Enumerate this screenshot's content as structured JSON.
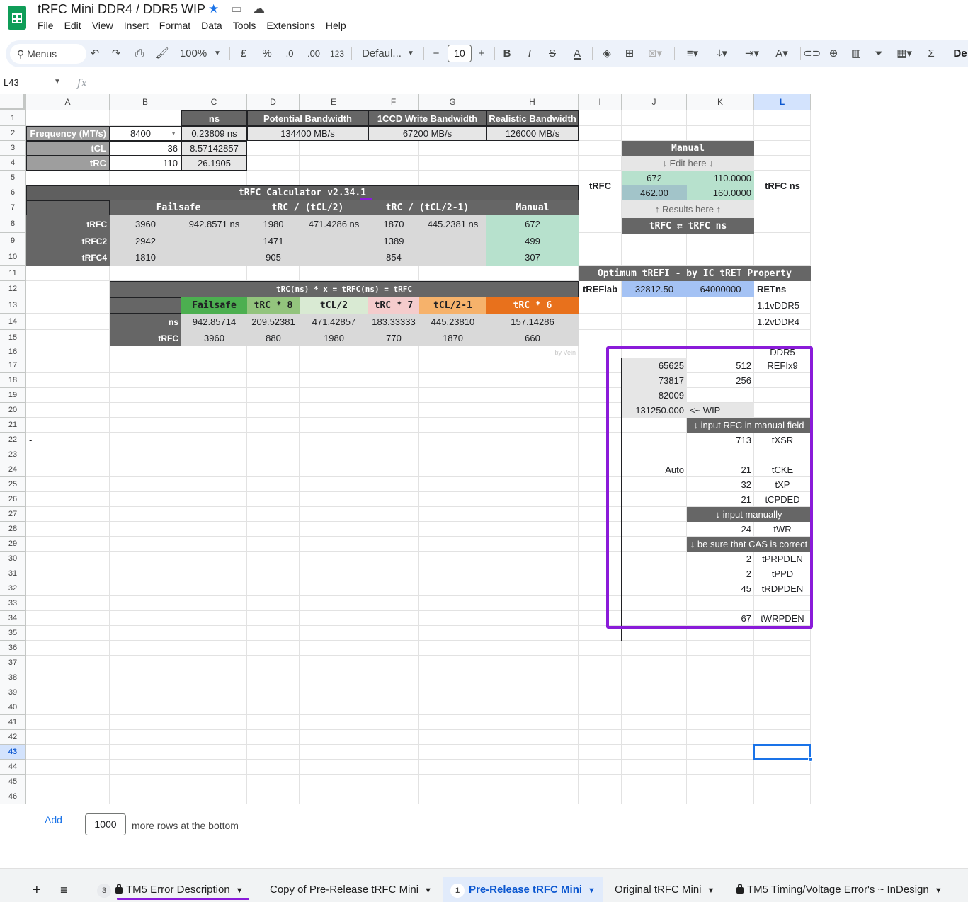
{
  "doc": {
    "title": "tRFC Mini DDR4 / DDR5 WIP"
  },
  "menu": [
    "File",
    "Edit",
    "View",
    "Insert",
    "Format",
    "Data",
    "Tools",
    "Extensions",
    "Help"
  ],
  "toolbar": {
    "search_label": "Menus",
    "zoom": "100%",
    "currency": "£",
    "percent": "%",
    "dec_less": ".0",
    "dec_more": ".00",
    "number_format": "123",
    "font": "Defaul...",
    "font_size": "10",
    "bold": "B",
    "italic": "I",
    "strike": "S",
    "text_color": "A",
    "overflow_label": "De"
  },
  "formula_bar": {
    "name_box": "L43",
    "fx": "fx"
  },
  "columns": [
    "A",
    "B",
    "C",
    "D",
    "E",
    "F",
    "G",
    "H",
    "I",
    "J",
    "K",
    "L"
  ],
  "rows": [
    "1",
    "2",
    "3",
    "4",
    "5",
    "6",
    "7",
    "8",
    "9",
    "10",
    "11",
    "12",
    "13",
    "14",
    "15",
    "16",
    "17",
    "18",
    "19",
    "20",
    "21",
    "22",
    "23",
    "24",
    "25",
    "26",
    "27",
    "28",
    "29",
    "30",
    "31",
    "32",
    "33",
    "34",
    "35",
    "36",
    "37",
    "38",
    "39",
    "40",
    "41",
    "42",
    "43",
    "44",
    "45",
    "46"
  ],
  "cells": {
    "c1": "ns",
    "d1": "Potential Bandwidth",
    "f1": "1CCD Write Bandwidth",
    "h1": "Realistic Bandwidth",
    "a2": "Frequency (MT/s)",
    "b2": "8400",
    "c2": "0.23809 ns",
    "d2": "134400 MB/s",
    "f2": "67200 MB/s",
    "h2": "126000 MB/s",
    "a3": "tCL",
    "b3": "36",
    "c3": "8.57142857",
    "a4": "tRC",
    "b4": "110",
    "c4": "26.1905",
    "calc_title": "tRFC Calculator v2.34.1",
    "b7": "Failsafe",
    "d7": "tRC / (tCL/2)",
    "f7": "tRC / (tCL/2-1)",
    "h7": "Manual",
    "a8": "tRFC",
    "b8": "3960",
    "c8": "942.8571 ns",
    "d8": "1980",
    "e8": "471.4286 ns",
    "f8": "1870",
    "g8": "445.2381 ns",
    "h8": "672",
    "a9": "tRFC2",
    "b9": "2942",
    "d9": "1471",
    "f9": "1389",
    "h9": "499",
    "a10": "tRFC4",
    "b10": "1810",
    "d10": "905",
    "f10": "854",
    "h10": "307",
    "formula_title": "tRC(ns) * x = tRFC(ns) = tRFC",
    "c13": "Failsafe",
    "d13": "tRC * 8",
    "e13": "tCL/2",
    "f13": "tRC * 7",
    "g13": "tCL/2-1",
    "h13": "tRC * 6",
    "b14": "ns",
    "c14": "942.85714",
    "d14": "209.52381",
    "e14": "471.42857",
    "f14": "183.33333",
    "g14": "445.23810",
    "h14": "157.14286",
    "b15": "tRFC",
    "c15": "3960",
    "d15": "880",
    "e15": "1980",
    "f15": "770",
    "g15": "1870",
    "h15": "660",
    "by_vein": "by Vein",
    "manual_title": "Manual",
    "edit_here": "Edit here",
    "j5": "672",
    "k5": "110.0000",
    "j6": "462.00",
    "k6": "160.0000",
    "results_here": "Results here",
    "trfc_conv": "tRFC ⇄ tRFC ns",
    "i6": "tRFC",
    "l6": "tRFC ns",
    "trefi_title": "Optimum tREFI - by IC tRET Property",
    "i12": "tREFlab",
    "j12": "32812.50",
    "k12": "64000000",
    "l12": "RETns",
    "l13": "1.1vDDR5",
    "l14": "1.2vDDR4",
    "l16": "DDR5",
    "j17": "65625",
    "k17": "512",
    "l17": "REFIx9",
    "j18": "73817",
    "k18": "256",
    "j19": "82009",
    "j20": "131250.000",
    "k20": "<~ WIP",
    "k21": "↓ input RFC in manual field",
    "a22": "-",
    "k22": "713",
    "l22": "tXSR",
    "j24": "Auto",
    "k24": "21",
    "l24": "tCKE",
    "k25": "32",
    "l25": "tXP",
    "k26": "21",
    "l26": "tCPDED",
    "k27": "↓ input manually",
    "k28": "24",
    "l28": "tWR",
    "k29": "↓ be sure that CAS is correct",
    "k30": "2",
    "l30": "tPRPDEN",
    "k31": "2",
    "l31": "tPPD",
    "k32": "45",
    "l32": "tRDPDEN",
    "k34": "67",
    "l34": "tWRPDEN"
  },
  "bottom": {
    "add_label": "Add",
    "add_count": "1000",
    "add_text": "more rows at the bottom"
  },
  "tabs": [
    {
      "label": "TM5 Error Description",
      "badge": "3",
      "locked": true
    },
    {
      "label": "Copy of Pre-Release tRFC Mini"
    },
    {
      "label": "Pre-Release tRFC Mini",
      "badge": "1",
      "active": true
    },
    {
      "label": "Original tRFC Mini"
    },
    {
      "label": "TM5 Timing/Voltage Error's ~ InDesign",
      "locked": true
    }
  ],
  "colors": {
    "accent": "#1a73e8",
    "annotation": "#8a1bd9",
    "dark_header": "#666666",
    "green": "#b7e1cd"
  }
}
